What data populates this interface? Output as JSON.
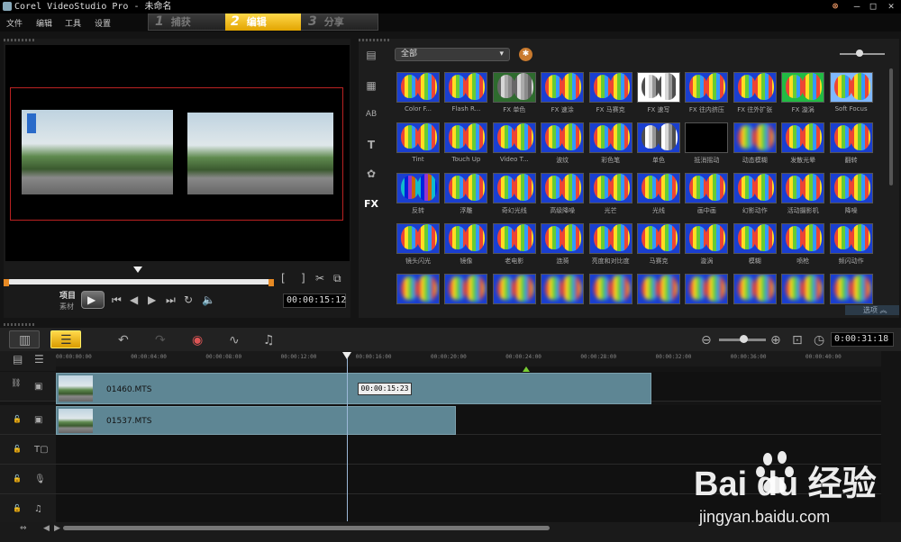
{
  "window": {
    "title": "Corel VideoStudio Pro - 未命名",
    "controls": [
      "–",
      "□",
      "✕"
    ]
  },
  "menu": [
    "文件",
    "编辑",
    "工具",
    "设置"
  ],
  "steps": [
    {
      "num": "1",
      "label": "捕获"
    },
    {
      "num": "2",
      "label": "编辑"
    },
    {
      "num": "3",
      "label": "分享"
    }
  ],
  "preview": {
    "mode_project": "项目",
    "mode_clip": "素材",
    "timecode": "00:00:15:12",
    "mark_in": "[",
    "mark_out": "]"
  },
  "library": {
    "folder": "全部",
    "options_label": "选项"
  },
  "fx": [
    "Color F...",
    "Flash R...",
    "FX 单色",
    "FX 速涂",
    "FX 马赛克",
    "FX 速写",
    "FX 往内挤压",
    "FX 往外扩张",
    "FX 漩涡",
    "Soft Focus",
    "Tint",
    "Touch Up",
    "Video T...",
    "波纹",
    "彩色笔",
    "单色",
    "抵消摇动",
    "动态模糊",
    "发散光晕",
    "翻转",
    "反转",
    "浮雕",
    "奇幻光线",
    "高级降噪",
    "光芒",
    "光线",
    "画中画",
    "幻影动作",
    "活动摄影机",
    "降噪",
    "镜头闪光",
    "镜像",
    "老电影",
    "涟漪",
    "亮度和对比度",
    "马赛克",
    "漩涡",
    "模糊",
    "喷枪",
    "频闪动作",
    "",
    "",
    "",
    "",
    "",
    "",
    "",
    "",
    "",
    ""
  ],
  "timeline": {
    "timecode": "0:00:31:18",
    "ruler": [
      "00:00:00:00",
      "00:00:04:00",
      "00:00:08:00",
      "00:00:12:00",
      "00:00:16:00",
      "00:00:20:00",
      "00:00:24:00",
      "00:00:28:00",
      "00:00:32:00",
      "00:00:36:00",
      "00:00:40:00"
    ],
    "clips": [
      {
        "name": "01460.MTS"
      },
      {
        "name": "01537.MTS"
      }
    ],
    "tooltip": "00:00:15:23"
  },
  "watermark": {
    "brand": "Bai du 经验",
    "url": "jingyan.baidu.com"
  }
}
